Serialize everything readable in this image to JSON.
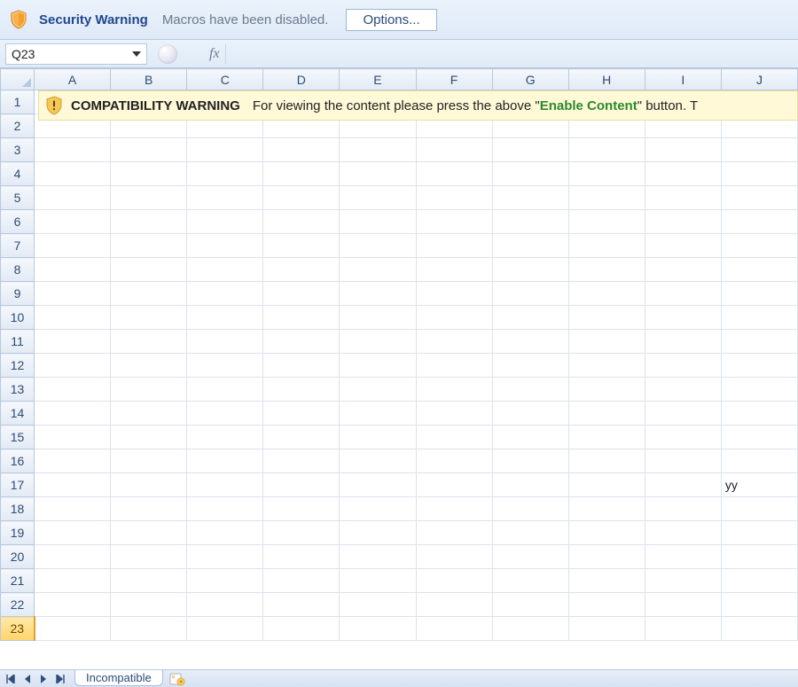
{
  "security": {
    "title": "Security Warning",
    "message": "Macros have been disabled.",
    "options_label": "Options..."
  },
  "namebox": {
    "cell_ref": "Q23",
    "fx_label": "fx",
    "formula_value": ""
  },
  "columns": [
    "A",
    "B",
    "C",
    "D",
    "E",
    "F",
    "G",
    "H",
    "I",
    "J"
  ],
  "rows": [
    1,
    2,
    3,
    4,
    5,
    6,
    7,
    8,
    9,
    10,
    11,
    12,
    13,
    14,
    15,
    16,
    17,
    18,
    19,
    20,
    21,
    22,
    23
  ],
  "active_row": 23,
  "cells": {
    "J17": "yy"
  },
  "compat": {
    "title": "COMPATIBILITY WARNING",
    "text_pre": "For viewing the content please press the above \"",
    "enable_label": "Enable Content",
    "text_post": "\" button. T"
  },
  "tabs": {
    "sheet_name": "Incompatible"
  }
}
